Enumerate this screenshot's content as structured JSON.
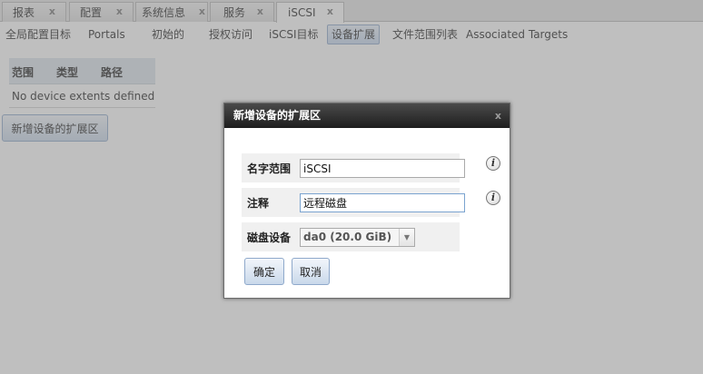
{
  "tabs": [
    {
      "label": "报表",
      "close": "x"
    },
    {
      "label": "配置",
      "close": "x"
    },
    {
      "label": "系统信息",
      "close": "x"
    },
    {
      "label": "服务",
      "close": "x"
    },
    {
      "label": "iSCSI",
      "close": "x"
    }
  ],
  "subtabs": [
    "全局配置目标",
    "Portals",
    "初始的",
    "授权访问",
    "iSCSI目标",
    "设备扩展",
    "文件范围列表",
    "Associated Targets"
  ],
  "active_subtab": "设备扩展",
  "grid": {
    "columns": [
      "范围",
      "类型",
      "路径"
    ],
    "empty_text": "No device extents defined"
  },
  "add_button": "新增设备的扩展区",
  "dialog": {
    "title": "新增设备的扩展区",
    "close": "x",
    "fields": {
      "name": {
        "label": "名字范围",
        "value": "iSCSI"
      },
      "comment": {
        "label": "注释",
        "value": "远程磁盘"
      },
      "disk": {
        "label": "磁盘设备",
        "value": "da0 (20.0 GiB)"
      }
    },
    "info_glyph": "i",
    "ok": "确定",
    "cancel": "取消"
  }
}
